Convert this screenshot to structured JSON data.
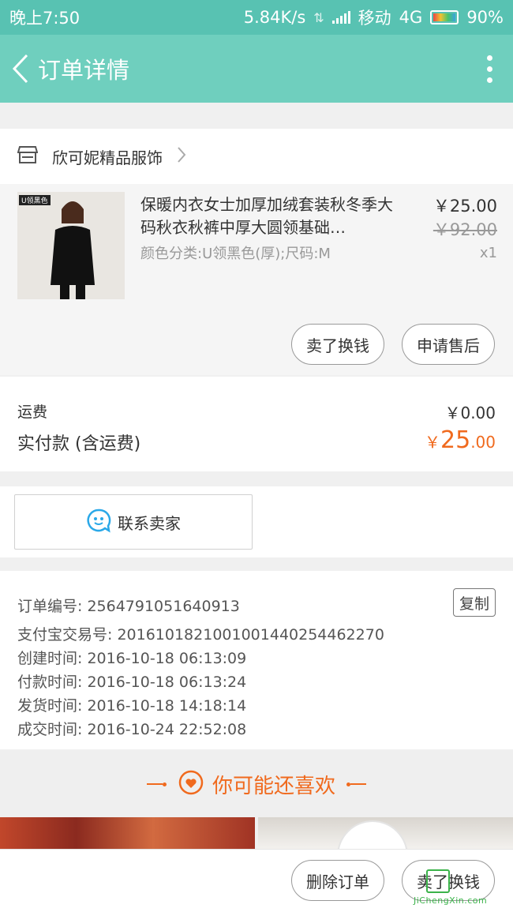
{
  "status": {
    "time": "晚上7:50",
    "speed": "5.84K/s",
    "carrier": "移动",
    "network": "4G",
    "battery": "90%"
  },
  "nav": {
    "title": "订单详情",
    "back_icon": "chevron-left-icon",
    "more_icon": "more-vertical-icon"
  },
  "shop": {
    "name": "欣可妮精品服饰",
    "icon": "store-icon"
  },
  "item": {
    "thumb_tag": "U领黑色",
    "title": "保暖内衣女士加厚加绒套装秋冬季大码秋衣秋裤中厚大圆领基础…",
    "spec": "颜色分类:U领黑色(厚);尺码:M",
    "price": "￥25.00",
    "original_price": "￥92.00",
    "quantity": "x1",
    "sell_label": "卖了换钱",
    "after_sale_label": "申请售后"
  },
  "payment": {
    "shipping_label": "运费",
    "shipping_value": "￥0.00",
    "total_label": "实付款 (含运费)",
    "total_currency": "￥",
    "total_int": "25",
    "total_dec": ".00"
  },
  "contact": {
    "label": "联系卖家",
    "icon": "chat-bubble-icon"
  },
  "order_info": {
    "order_no": "订单编号: 2564791051640913",
    "copy_label": "复制",
    "alipay_no": "支付宝交易号: 2016101821001001440254462270",
    "created": "创建时间: 2016-10-18 06:13:09",
    "paid": "付款时间: 2016-10-18 06:13:24",
    "shipped": "发货时间: 2016-10-18 14:18:14",
    "completed": "成交时间: 2016-10-24 22:52:08"
  },
  "recommend": {
    "title": "你可能还喜欢",
    "icon": "heart-circle-icon"
  },
  "bottom": {
    "delete_label": "删除订单",
    "sell_label": "卖了换钱"
  },
  "watermark": {
    "text": "JiChengXin.com"
  },
  "colors": {
    "status_bar": "#58c2b2",
    "nav_bar": "#6fcfbe",
    "accent": "#f06a1e"
  }
}
